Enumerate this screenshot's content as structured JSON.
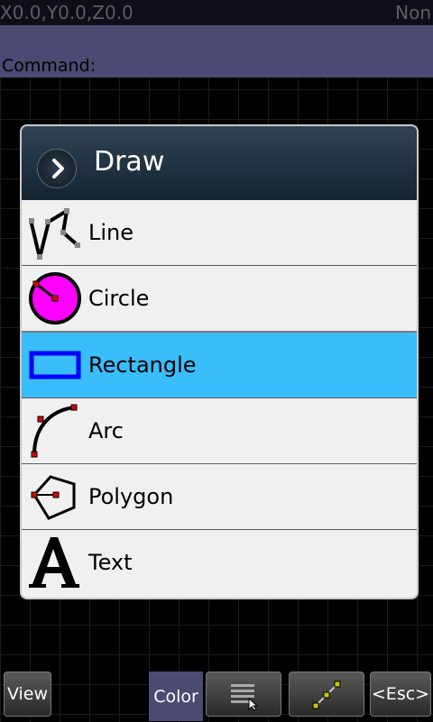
{
  "status": {
    "coords": "X0.0,Y0.0,Z0.0",
    "snap": "Non"
  },
  "command": {
    "prompt": "Command:"
  },
  "dialog": {
    "title": "Draw",
    "items": [
      {
        "label": "Line",
        "icon": "line-icon"
      },
      {
        "label": "Circle",
        "icon": "circle-icon"
      },
      {
        "label": "Rectangle",
        "icon": "rectangle-icon",
        "selected": true
      },
      {
        "label": "Arc",
        "icon": "arc-icon"
      },
      {
        "label": "Polygon",
        "icon": "polygon-icon"
      },
      {
        "label": "Text",
        "icon": "text-icon"
      }
    ]
  },
  "toolbar": {
    "view_label": "View",
    "color_label": "Color",
    "esc_label": "<Esc>"
  },
  "colors": {
    "selection": "#39bdfb",
    "circle_fill": "#ff00ff",
    "rectangle_stroke": "#0000ff",
    "handle": "#e00000"
  }
}
